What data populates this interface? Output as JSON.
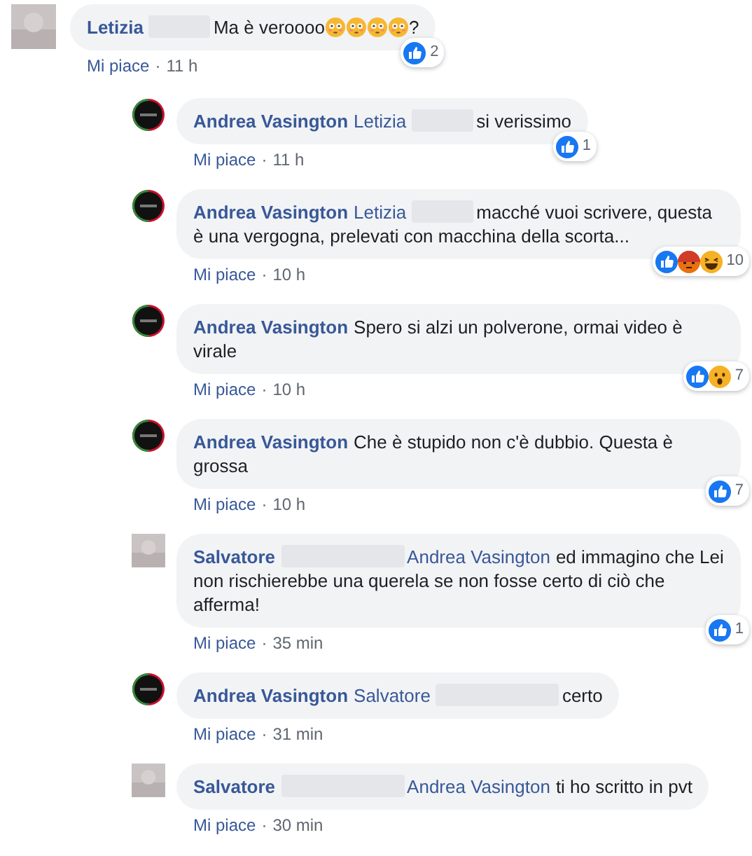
{
  "comments": [
    {
      "avatar": {
        "kind": "blurred"
      },
      "segments": [
        {
          "kind": "author",
          "text": "Letizia"
        },
        {
          "kind": "redacted"
        },
        {
          "kind": "text",
          "text": "Ma è veroooo"
        },
        {
          "kind": "emoji"
        },
        {
          "kind": "emoji"
        },
        {
          "kind": "emoji"
        },
        {
          "kind": "emoji"
        },
        {
          "kind": "text",
          "text": "?"
        }
      ],
      "reactions": [
        {
          "kind": "like"
        }
      ],
      "count": "2",
      "like_label": "Mi piace",
      "separator": "·",
      "time": "11 h",
      "children": [
        {
          "avatar": {
            "kind": "logo"
          },
          "segments": [
            {
              "kind": "author",
              "text": "Andrea Vasington"
            },
            {
              "kind": "mention",
              "text": "Letizia"
            },
            {
              "kind": "redacted"
            },
            {
              "kind": "text",
              "text": "si verissimo"
            }
          ],
          "reactions": [
            {
              "kind": "like"
            }
          ],
          "count": "1",
          "like_label": "Mi piace",
          "separator": "·",
          "time": "11 h"
        },
        {
          "avatar": {
            "kind": "logo"
          },
          "segments": [
            {
              "kind": "author",
              "text": "Andrea Vasington"
            },
            {
              "kind": "mention",
              "text": "Letizia"
            },
            {
              "kind": "redacted"
            },
            {
              "kind": "text",
              "text": "macché vuoi scrivere, questa è una vergogna, prelevati con macchina della scorta..."
            }
          ],
          "reactions": [
            {
              "kind": "like"
            },
            {
              "kind": "angry"
            },
            {
              "kind": "haha"
            }
          ],
          "count": "10",
          "like_label": "Mi piace",
          "separator": "·",
          "time": "10 h"
        },
        {
          "avatar": {
            "kind": "logo"
          },
          "segments": [
            {
              "kind": "author",
              "text": "Andrea Vasington"
            },
            {
              "kind": "text",
              "text": "Spero si alzi un polverone, ormai video è virale"
            }
          ],
          "reactions": [
            {
              "kind": "like"
            },
            {
              "kind": "wow"
            }
          ],
          "count": "7",
          "like_label": "Mi piace",
          "separator": "·",
          "time": "10 h"
        },
        {
          "avatar": {
            "kind": "logo"
          },
          "segments": [
            {
              "kind": "author",
              "text": "Andrea Vasington"
            },
            {
              "kind": "text",
              "text": "Che è stupido non c'è dubbio. Questa è grossa"
            }
          ],
          "reactions": [
            {
              "kind": "like"
            }
          ],
          "count": "7",
          "like_label": "Mi piace",
          "separator": "·",
          "time": "10 h"
        },
        {
          "avatar": {
            "kind": "blurred"
          },
          "segments": [
            {
              "kind": "author",
              "text": "Salvatore"
            },
            {
              "kind": "redacted",
              "wide": true
            },
            {
              "kind": "mention",
              "text": "Andrea Vasington"
            },
            {
              "kind": "text",
              "text": "ed immagino che Lei non rischierebbe una querela se non fosse certo di ciò che afferma!"
            }
          ],
          "reactions": [
            {
              "kind": "like"
            }
          ],
          "count": "1",
          "like_label": "Mi piace",
          "separator": "·",
          "time": "35 min"
        },
        {
          "avatar": {
            "kind": "logo"
          },
          "segments": [
            {
              "kind": "author",
              "text": "Andrea Vasington"
            },
            {
              "kind": "mention",
              "text": "Salvatore"
            },
            {
              "kind": "redacted",
              "wide": true
            },
            {
              "kind": "text",
              "text": "certo"
            }
          ],
          "like_label": "Mi piace",
          "separator": "·",
          "time": "31 min"
        },
        {
          "avatar": {
            "kind": "blurred"
          },
          "segments": [
            {
              "kind": "author",
              "text": "Salvatore"
            },
            {
              "kind": "redacted",
              "wide": true
            },
            {
              "kind": "mention",
              "text": "Andrea Vasington"
            },
            {
              "kind": "text",
              "text": "ti ho scritto in pvt"
            }
          ],
          "like_label": "Mi piace",
          "separator": "·",
          "time": "30 min"
        }
      ]
    }
  ]
}
